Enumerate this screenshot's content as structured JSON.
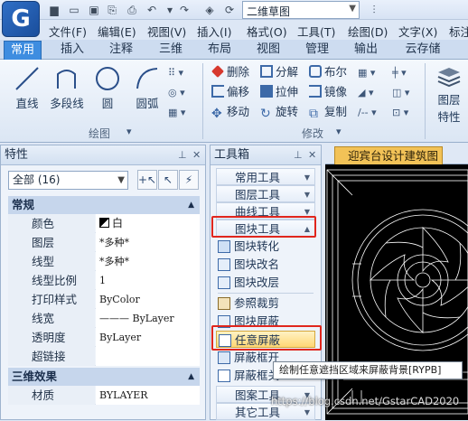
{
  "app": {
    "logo_letter": "G",
    "document_select": "二维草图"
  },
  "menu": [
    "文件(F)",
    "编辑(E)",
    "视图(V)",
    "插入(I)",
    "格式(O)",
    "工具(T)",
    "绘图(D)",
    "文字(X)",
    "标注"
  ],
  "ribbon_tabs": [
    "常用",
    "插入",
    "注释",
    "三维",
    "布局",
    "视图",
    "管理",
    "输出",
    "云存储"
  ],
  "ribbon": {
    "draw_buttons": [
      "直线",
      "多段线",
      "圆",
      "圆弧"
    ],
    "draw_group_label": "绘图",
    "modify_buttons": [
      "删除",
      "分解",
      "布尔",
      "偏移",
      "拉伸",
      "镜像",
      "移动",
      "旋转",
      "复制"
    ],
    "modify_group_label": "修改",
    "layer_button": [
      "图层",
      "特性"
    ]
  },
  "properties": {
    "title": "特性",
    "selection": "全部 (16)",
    "general_section": "常规",
    "rows": [
      {
        "key": "颜色",
        "value": "白"
      },
      {
        "key": "图层",
        "value": "*多种*"
      },
      {
        "key": "线型",
        "value": "*多种*"
      },
      {
        "key": "线型比例",
        "value": "1"
      },
      {
        "key": "打印样式",
        "value": "ByColor"
      },
      {
        "key": "线宽",
        "value": "——— ByLayer"
      },
      {
        "key": "透明度",
        "value": "ByLayer"
      },
      {
        "key": "超链接",
        "value": ""
      }
    ],
    "threed_section": "三维效果",
    "threed_rows": [
      {
        "key": "材质",
        "value": "BYLAYER"
      }
    ]
  },
  "toolbox": {
    "title": "工具箱",
    "categories_top": [
      "常用工具",
      "图层工具",
      "曲线工具",
      "图块工具"
    ],
    "items": [
      "图块转化",
      "图块改名",
      "图块改层",
      "参照裁剪",
      "图块屏蔽",
      "任意屏蔽",
      "屏蔽框开",
      "屏蔽框关"
    ],
    "categories_bottom": [
      "图案工具",
      "其它工具"
    ]
  },
  "drawing": {
    "tab_label": "迎宾台设计建筑图"
  },
  "tooltip": "绘制任意遮挡区域来屏蔽背景[RYPB]",
  "watermark": "https://blog.csdn.net/GstarCAD2020",
  "colors": {
    "accent": "#3e8de0",
    "highlight_box": "#e0261d",
    "drawing_tab": "#f2c257"
  }
}
